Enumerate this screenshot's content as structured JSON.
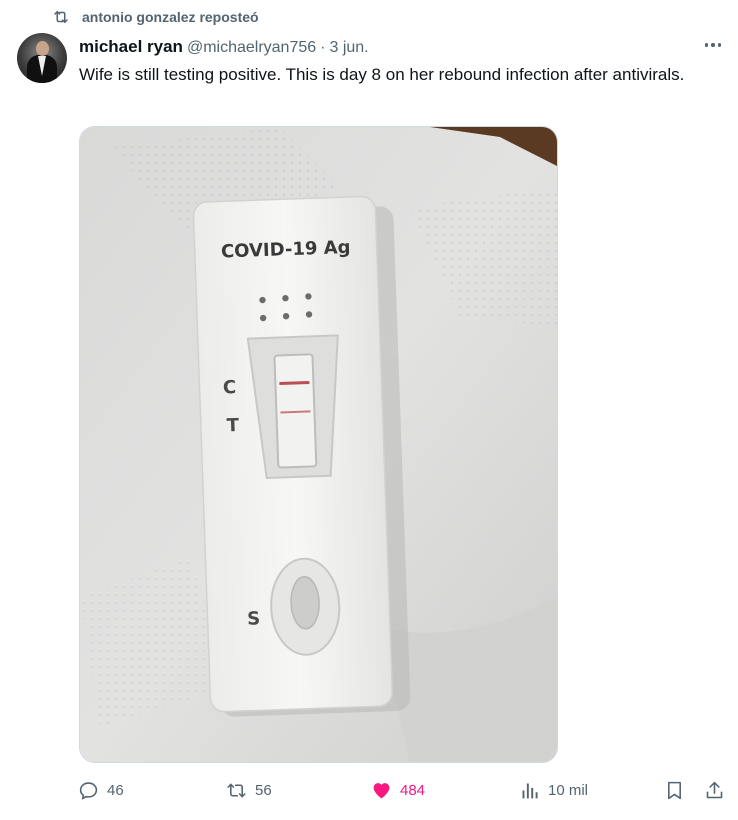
{
  "retweet": {
    "text": "antonio gonzalez reposteó",
    "icon": "retweet-icon"
  },
  "tweet": {
    "author_name": "michael ryan",
    "author_handle": "@michaelryan756",
    "separator": "·",
    "time": "3 jun.",
    "text": "Wife is still testing positive. This is day 8 on her rebound infection after antivirals."
  },
  "media": {
    "test_label": "COVID-19 Ag",
    "control_label": "C",
    "test_line_label": "T",
    "sample_label": "S"
  },
  "actions": {
    "replies": "46",
    "reposts": "56",
    "likes": "484",
    "views": "10 mil"
  },
  "colors": {
    "like": "#f91880",
    "secondary": "#536471",
    "text": "#0f1419"
  }
}
